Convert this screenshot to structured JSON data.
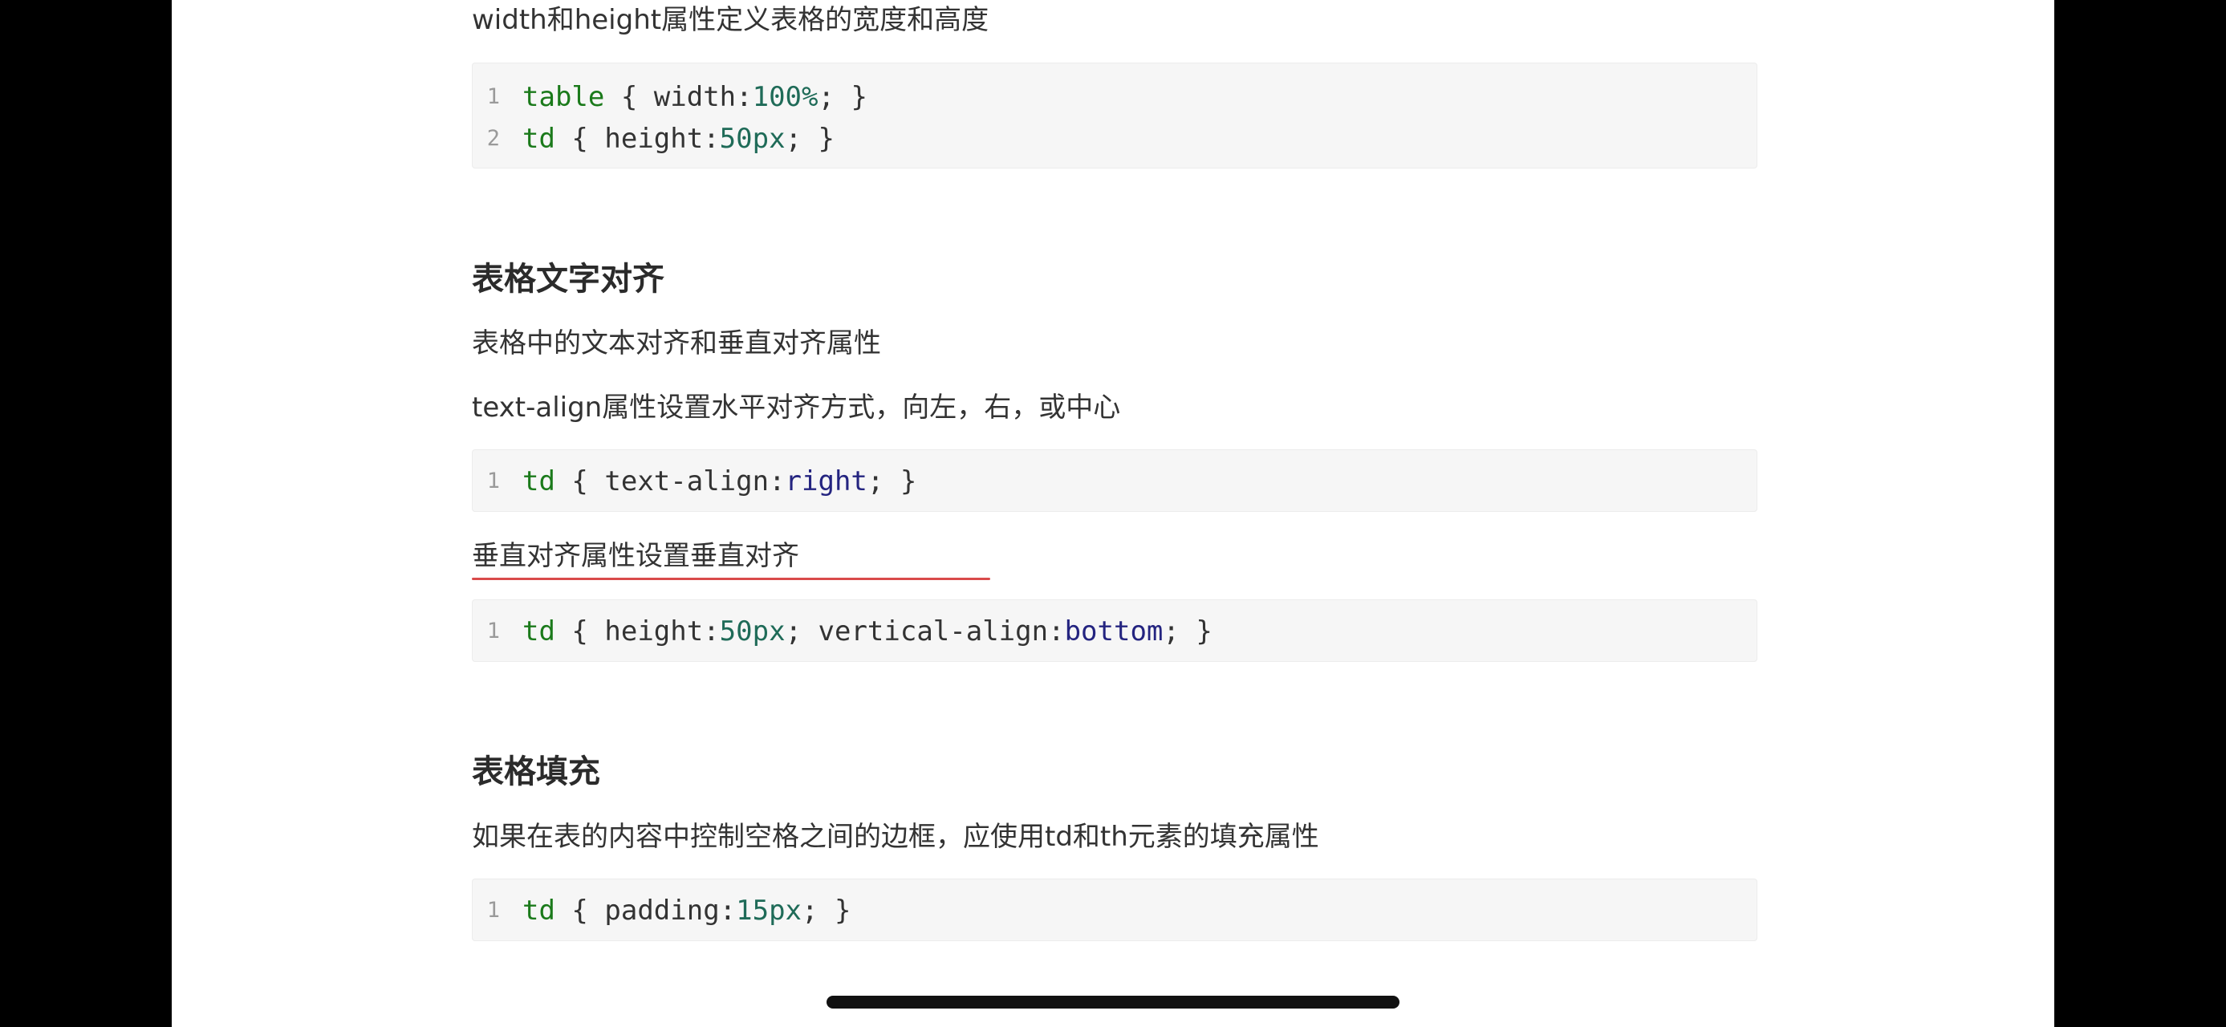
{
  "article": {
    "intro_text": "width和height属性定义表格的宽度和高度",
    "code_size": {
      "lines": [
        [
          {
            "t": "table",
            "c": "sel"
          },
          {
            "t": " { ",
            "c": "punct"
          },
          {
            "t": "width:",
            "c": "punct"
          },
          {
            "t": "100%",
            "c": "num"
          },
          {
            "t": "; }",
            "c": "punct"
          }
        ],
        [
          {
            "t": "td",
            "c": "sel"
          },
          {
            "t": " { ",
            "c": "punct"
          },
          {
            "t": "height:",
            "c": "punct"
          },
          {
            "t": "50px",
            "c": "num"
          },
          {
            "t": "; }",
            "c": "punct"
          }
        ]
      ]
    },
    "section_align": {
      "heading": "表格文字对齐",
      "para_1": "表格中的文本对齐和垂直对齐属性",
      "para_2": "text-align属性设置水平对齐方式，向左，右，或中心",
      "code_text_align": {
        "lines": [
          [
            {
              "t": "td",
              "c": "sel"
            },
            {
              "t": " { ",
              "c": "punct"
            },
            {
              "t": "text-align:",
              "c": "punct"
            },
            {
              "t": "right",
              "c": "kw"
            },
            {
              "t": "; }",
              "c": "punct"
            }
          ]
        ]
      },
      "para_3": "垂直对齐属性设置垂直对齐",
      "code_vertical_align": {
        "lines": [
          [
            {
              "t": "td",
              "c": "sel"
            },
            {
              "t": " { ",
              "c": "punct"
            },
            {
              "t": "height:",
              "c": "punct"
            },
            {
              "t": "50px",
              "c": "num"
            },
            {
              "t": "; vertical-align:",
              "c": "punct"
            },
            {
              "t": "bottom",
              "c": "kw"
            },
            {
              "t": "; }",
              "c": "punct"
            }
          ]
        ]
      }
    },
    "section_padding": {
      "heading": "表格填充",
      "para_1": "如果在表的内容中控制空格之间的边框，应使用td和th元素的填充属性",
      "code_padding": {
        "lines": [
          [
            {
              "t": "td",
              "c": "sel"
            },
            {
              "t": " { ",
              "c": "punct"
            },
            {
              "t": "padding:",
              "c": "punct"
            },
            {
              "t": "15px",
              "c": "num"
            },
            {
              "t": "; }",
              "c": "punct"
            }
          ]
        ]
      }
    }
  }
}
